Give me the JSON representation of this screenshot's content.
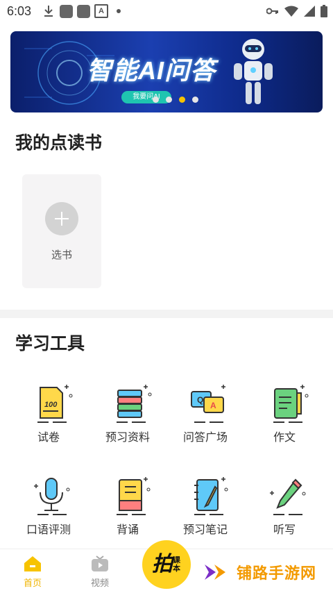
{
  "status_bar": {
    "time": "6:03",
    "icons": [
      "download-icon",
      "app-icon",
      "app-icon",
      "text-a-icon",
      "notification-dot-icon",
      "key-icon",
      "wifi-icon",
      "signal-icon",
      "battery-icon"
    ]
  },
  "banner": {
    "title": "智能AI问答",
    "button_label": "我要问AI",
    "dots": 4,
    "active_dot": 3
  },
  "my_books": {
    "title": "我的点读书",
    "add_label": "选书"
  },
  "tools": {
    "title": "学习工具",
    "items": [
      {
        "label": "试卷",
        "icon": "exam-icon"
      },
      {
        "label": "预习资料",
        "icon": "books-icon"
      },
      {
        "label": "问答广场",
        "icon": "qa-icon"
      },
      {
        "label": "作文",
        "icon": "essay-icon"
      },
      {
        "label": "口语评测",
        "icon": "microphone-icon"
      },
      {
        "label": "背诵",
        "icon": "recite-icon"
      },
      {
        "label": "预习笔记",
        "icon": "notes-icon"
      },
      {
        "label": "听写",
        "icon": "pencil-icon"
      }
    ]
  },
  "bottom_nav": {
    "items": [
      {
        "label": "首页",
        "icon": "home-icon",
        "active": true
      },
      {
        "label": "视频",
        "icon": "tv-icon",
        "active": false
      }
    ],
    "center_main": "拍",
    "center_sub": "课本"
  },
  "watermark": {
    "text": "铺路手游网"
  },
  "colors": {
    "accent": "#f7c300",
    "banner_bg": "#1b3fb0",
    "divider": "#f3f3f3"
  }
}
